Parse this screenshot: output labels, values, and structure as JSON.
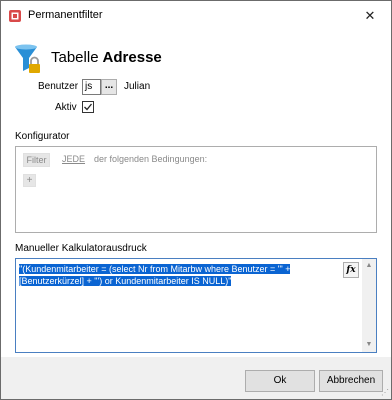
{
  "window": {
    "title": "Permanentfilter",
    "close_glyph": "✕"
  },
  "table": {
    "label": "Tabelle",
    "name": "Adresse"
  },
  "benutzer": {
    "label": "Benutzer",
    "value": "js",
    "browse_label": "...",
    "name": "Julian"
  },
  "aktiv": {
    "label": "Aktiv",
    "checked": true,
    "check_glyph": "✓"
  },
  "konfigurator": {
    "label": "Konfigurator",
    "filter_label": "Filter",
    "quantifier": "JEDE",
    "condition_text": "der folgenden Bedingungen:",
    "add_glyph": "+"
  },
  "expression": {
    "label": "Manueller Kalkulatorausdruck",
    "line1": "\"(Kundenmitarbeiter = (select Nr from Mitarbw where Benutzer = '\" +",
    "line2": "[Benutzerkürzel] + \"') or Kundenmitarbeiter IS NULL)\"",
    "fx_label": "fx"
  },
  "buttons": {
    "ok": "Ok",
    "cancel": "Abbrechen"
  },
  "colors": {
    "selection": "#0a64d2",
    "funnel": "#2a8fd6",
    "lock": "#e0a800"
  }
}
